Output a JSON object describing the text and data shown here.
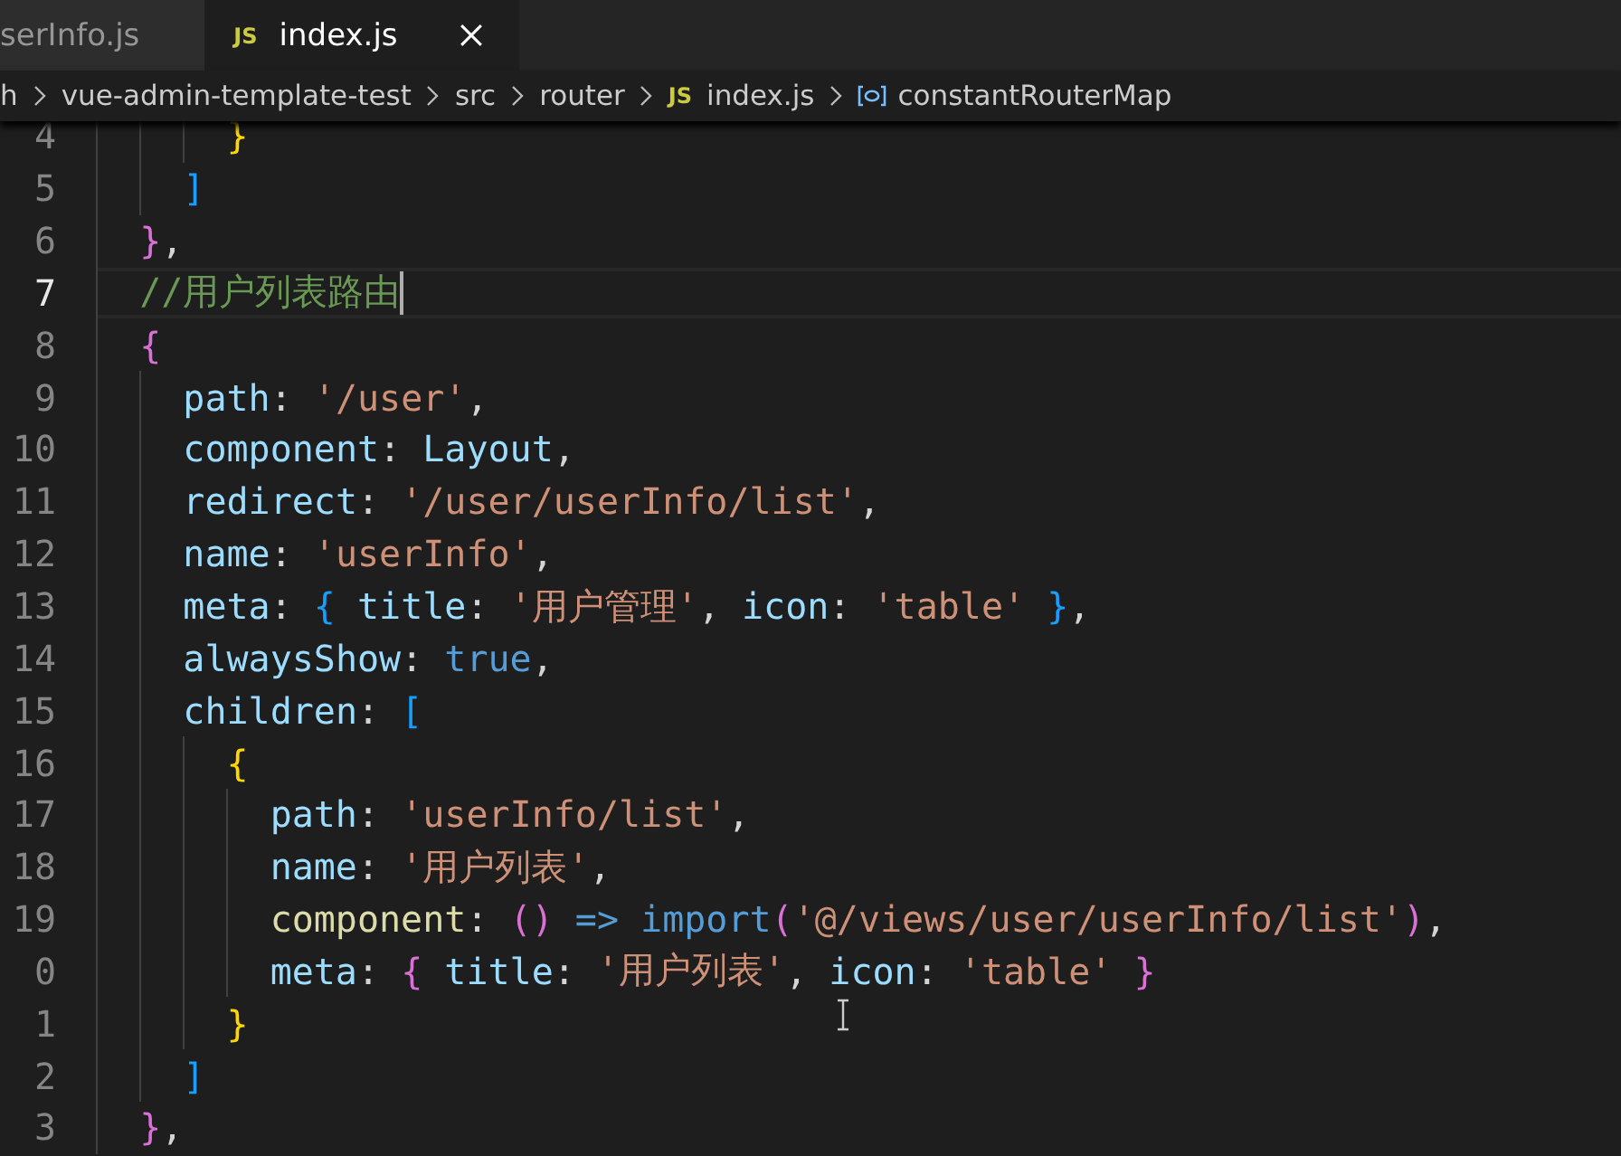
{
  "tabs": [
    {
      "label": "serInfo.js",
      "selected": false
    },
    {
      "label": "index.js",
      "selected": true,
      "badge": "JS"
    }
  ],
  "breadcrumb": [
    {
      "label": "h",
      "kind": "folder"
    },
    {
      "label": "vue-admin-template-test",
      "kind": "folder"
    },
    {
      "label": "src",
      "kind": "folder"
    },
    {
      "label": "router",
      "kind": "folder"
    },
    {
      "label": "index.js",
      "kind": "file",
      "badge": "JS"
    },
    {
      "label": "constantRouterMap",
      "kind": "symbol"
    }
  ],
  "lines": [
    {
      "number": "4",
      "current": false,
      "cursor": false,
      "tokens": [
        {
          "text": "}",
          "kind": "bracket1"
        }
      ]
    },
    {
      "number": "5",
      "current": false,
      "cursor": false,
      "tokens": [
        {
          "text": "]",
          "kind": "bracket3"
        }
      ]
    },
    {
      "number": "6",
      "current": false,
      "cursor": false,
      "tokens": [
        {
          "text": "}",
          "kind": "bracket2"
        },
        {
          "text": ",",
          "kind": "punct"
        }
      ]
    },
    {
      "number": "7",
      "current": true,
      "cursor": true,
      "tokens": [
        {
          "text": "//用户列表路由",
          "kind": "comment"
        }
      ]
    },
    {
      "number": "8",
      "current": false,
      "cursor": false,
      "tokens": [
        {
          "text": "{",
          "kind": "bracket2"
        }
      ]
    },
    {
      "number": "9",
      "current": false,
      "cursor": false,
      "tokens": [
        {
          "text": "path",
          "kind": "key"
        },
        {
          "text": ": ",
          "kind": "punct"
        },
        {
          "text": "'/user'",
          "kind": "string"
        },
        {
          "text": ",",
          "kind": "punct"
        }
      ]
    },
    {
      "number": "10",
      "current": false,
      "cursor": false,
      "tokens": [
        {
          "text": "component",
          "kind": "key"
        },
        {
          "text": ": ",
          "kind": "punct"
        },
        {
          "text": "Layout",
          "kind": "key"
        },
        {
          "text": ",",
          "kind": "punct"
        }
      ]
    },
    {
      "number": "11",
      "current": false,
      "cursor": false,
      "tokens": [
        {
          "text": "redirect",
          "kind": "key"
        },
        {
          "text": ": ",
          "kind": "punct"
        },
        {
          "text": "'/user/userInfo/list'",
          "kind": "string"
        },
        {
          "text": ",",
          "kind": "punct"
        }
      ]
    },
    {
      "number": "12",
      "current": false,
      "cursor": false,
      "tokens": [
        {
          "text": "name",
          "kind": "key"
        },
        {
          "text": ": ",
          "kind": "punct"
        },
        {
          "text": "'userInfo'",
          "kind": "string"
        },
        {
          "text": ",",
          "kind": "punct"
        }
      ]
    },
    {
      "number": "13",
      "current": false,
      "cursor": false,
      "tokens": [
        {
          "text": "meta",
          "kind": "key"
        },
        {
          "text": ": ",
          "kind": "punct"
        },
        {
          "text": "{",
          "kind": "bracket3"
        },
        {
          "text": " title",
          "kind": "key"
        },
        {
          "text": ": ",
          "kind": "punct"
        },
        {
          "text": "'用户管理'",
          "kind": "string"
        },
        {
          "text": ", ",
          "kind": "punct"
        },
        {
          "text": "icon",
          "kind": "key"
        },
        {
          "text": ": ",
          "kind": "punct"
        },
        {
          "text": "'table' ",
          "kind": "string"
        },
        {
          "text": "}",
          "kind": "bracket3"
        },
        {
          "text": ",",
          "kind": "punct"
        }
      ]
    },
    {
      "number": "14",
      "current": false,
      "cursor": false,
      "tokens": [
        {
          "text": "alwaysShow",
          "kind": "key"
        },
        {
          "text": ": ",
          "kind": "punct"
        },
        {
          "text": "true",
          "kind": "keyword"
        },
        {
          "text": ",",
          "kind": "punct"
        }
      ]
    },
    {
      "number": "15",
      "current": false,
      "cursor": false,
      "tokens": [
        {
          "text": "children",
          "kind": "key"
        },
        {
          "text": ": ",
          "kind": "punct"
        },
        {
          "text": "[",
          "kind": "bracket3"
        }
      ]
    },
    {
      "number": "16",
      "current": false,
      "cursor": false,
      "tokens": [
        {
          "text": "{",
          "kind": "bracket1"
        }
      ]
    },
    {
      "number": "17",
      "current": false,
      "cursor": false,
      "tokens": [
        {
          "text": "path",
          "kind": "key"
        },
        {
          "text": ": ",
          "kind": "punct"
        },
        {
          "text": "'userInfo/list'",
          "kind": "string"
        },
        {
          "text": ",",
          "kind": "punct"
        }
      ]
    },
    {
      "number": "18",
      "current": false,
      "cursor": false,
      "tokens": [
        {
          "text": "name",
          "kind": "key"
        },
        {
          "text": ": ",
          "kind": "punct"
        },
        {
          "text": "'用户列表'",
          "kind": "string"
        },
        {
          "text": ",",
          "kind": "punct"
        }
      ]
    },
    {
      "number": "19",
      "current": false,
      "cursor": false,
      "tokens": [
        {
          "text": "component",
          "kind": "function"
        },
        {
          "text": ": ",
          "kind": "punct"
        },
        {
          "text": "() ",
          "kind": "bracket2"
        },
        {
          "text": "=> ",
          "kind": "keyword"
        },
        {
          "text": "import",
          "kind": "keyword"
        },
        {
          "text": "(",
          "kind": "bracket2"
        },
        {
          "text": "'@/views/user/userInfo/list'",
          "kind": "string"
        },
        {
          "text": ")",
          "kind": "bracket2"
        },
        {
          "text": ",",
          "kind": "punct"
        }
      ]
    },
    {
      "number": "0",
      "current": false,
      "cursor": false,
      "tokens": [
        {
          "text": "meta",
          "kind": "key"
        },
        {
          "text": ": ",
          "kind": "punct"
        },
        {
          "text": "{",
          "kind": "bracket2"
        },
        {
          "text": " title",
          "kind": "key"
        },
        {
          "text": ": ",
          "kind": "punct"
        },
        {
          "text": "'用户列表'",
          "kind": "string"
        },
        {
          "text": ", ",
          "kind": "punct"
        },
        {
          "text": "icon",
          "kind": "key"
        },
        {
          "text": ": ",
          "kind": "punct"
        },
        {
          "text": "'table' ",
          "kind": "string"
        },
        {
          "text": "}",
          "kind": "bracket2"
        }
      ]
    },
    {
      "number": "1",
      "current": false,
      "cursor": false,
      "tokens": [
        {
          "text": "}",
          "kind": "bracket1"
        }
      ]
    },
    {
      "number": "2",
      "current": false,
      "cursor": false,
      "tokens": [
        {
          "text": "]",
          "kind": "bracket3"
        }
      ]
    },
    {
      "number": "3",
      "current": false,
      "cursor": false,
      "tokens": [
        {
          "text": "}",
          "kind": "bracket2"
        },
        {
          "text": ",",
          "kind": "punct"
        }
      ]
    }
  ]
}
